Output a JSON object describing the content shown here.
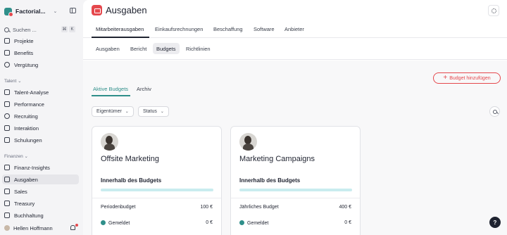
{
  "sidebar": {
    "org_name": "Factorial...",
    "search_placeholder": "Suchen ...",
    "shortcut_cmd": "⌘",
    "shortcut_key": "K",
    "items_top": [
      {
        "label": "Projekte"
      },
      {
        "label": "Benefits"
      },
      {
        "label": "Vergütung"
      }
    ],
    "section_talent": "Talent ⌄",
    "items_talent": [
      {
        "label": "Talent-Analyse"
      },
      {
        "label": "Performance"
      },
      {
        "label": "Recruiting"
      },
      {
        "label": "Interaktion"
      },
      {
        "label": "Schulungen"
      }
    ],
    "section_finance": "Finanzen ⌄",
    "items_finance": [
      {
        "label": "Finanz-Insights"
      },
      {
        "label": "Ausgaben"
      },
      {
        "label": "Sales"
      },
      {
        "label": "Treasury"
      },
      {
        "label": "Buchhaltung"
      }
    ],
    "user_name": "Hellen Hoffmann"
  },
  "header": {
    "title": "Ausgaben",
    "tabs": [
      {
        "label": "Mitarbeiterausgaben"
      },
      {
        "label": "Einkaufsrechnungen"
      },
      {
        "label": "Beschaffung"
      },
      {
        "label": "Software"
      },
      {
        "label": "Anbieter"
      }
    ],
    "subtabs": [
      {
        "label": "Ausgaben"
      },
      {
        "label": "Bericht"
      },
      {
        "label": "Budgets"
      },
      {
        "label": "Richtlinien"
      }
    ]
  },
  "budgets": {
    "add_button_label": "Budget hinzufügen",
    "view_tabs": [
      {
        "label": "Aktive Budgets"
      },
      {
        "label": "Archiv"
      }
    ],
    "filters": [
      {
        "label": "Eigentümer"
      },
      {
        "label": "Status"
      }
    ],
    "cards": [
      {
        "title": "Offsite Marketing",
        "status": "Innerhalb des Budgets",
        "progress": 0,
        "budget_label": "Periodenbudget",
        "budget_value": "100 €",
        "reported_label": "Gemeldet",
        "reported_value": "0 €"
      },
      {
        "title": "Marketing Campaigns",
        "status": "Innerhalb des Budgets",
        "progress": 0,
        "budget_label": "Jährliches Budget",
        "budget_value": "400 €",
        "reported_label": "Gemeldet",
        "reported_value": "0 €"
      }
    ]
  },
  "help_label": "?",
  "colors": {
    "accent": "#2f8f8a",
    "brand_red": "#e5484d",
    "progress_track": "#c9ecef"
  }
}
